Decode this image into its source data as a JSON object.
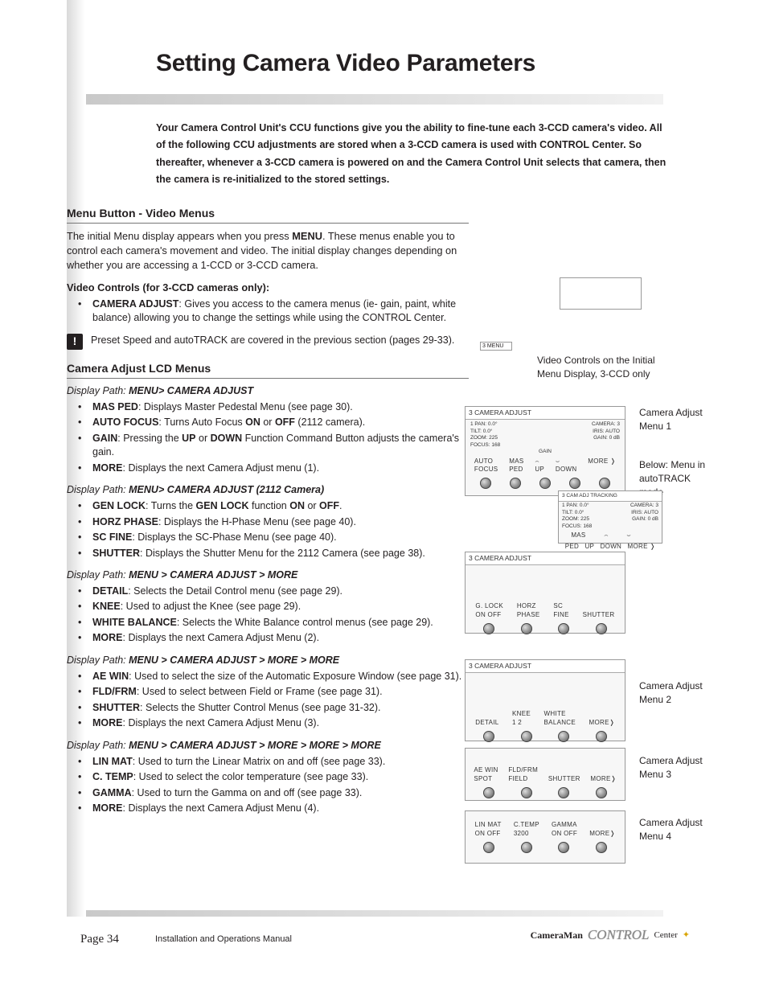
{
  "title": "Setting Camera Video Parameters",
  "intro": "Your Camera Control Unit's CCU functions give you the ability to fine-tune each 3-CCD camera's video. All of the following CCU adjustments are stored when a 3-CCD camera is used with CONTROL Center.  So thereafter, whenever a 3-CCD camera is powered on and the Camera Control Unit  selects that camera, then the camera is re-initialized to the stored settings.",
  "s1": {
    "heading": "Menu Button - Video Menus",
    "para": "The initial Menu display appears when you press <b>MENU</b>. These menus enable you to control each camera's movement and video. The initial display changes depending on whether you are accessing a 1-CCD or 3-CCD camera.",
    "sub": "Video Controls (for 3-CCD cameras only):",
    "item": "<b>CAMERA ADJUST</b>: Gives you access to the camera menus (ie- gain, paint, white balance) allowing you to change the settings while using the CONTROL Center.",
    "note": "Preset Speed and autoTRACK are covered in the previous section (pages 29-33)."
  },
  "s2": {
    "heading": "Camera Adjust LCD Menus",
    "p1_label": "Display Path:",
    "p1_path": "MENU> CAMERA ADJUST",
    "p1": {
      "a": "<b>MAS PED</b>: Displays Master Pedestal Menu (see page 30).",
      "b": "<b>AUTO FOCUS</b>: Turns Auto Focus <b>ON</b> or <b>OFF</b> (2112 camera).",
      "c": "<b>GAIN</b>: Pressing the <b>UP</b> or <b>DOWN</b> Function Command Button adjusts the camera's gain.",
      "d": "<b>MORE</b>: Displays the next Camera Adjust menu (1)."
    },
    "p2_label": "Display Path:",
    "p2_path": "MENU> CAMERA ADJUST (2112 Camera)",
    "p2": {
      "a": "<b>GEN LOCK</b>: Turns the <b>GEN LOCK</b> function <b>ON</b> or <b>OFF</b>.",
      "b": "<b>HORZ PHASE</b>: Displays the H-Phase Menu (see page 40).",
      "c": "<b>SC FINE</b>: Displays the SC-Phase Menu (see page 40).",
      "d": "<b>SHUTTER</b>: Displays the Shutter Menu for the 2112 Camera (see page 38)."
    },
    "p3_label": "Display Path:",
    "p3_path": "MENU > CAMERA ADJUST > MORE",
    "p3": {
      "a": "<b>DETAIL</b>: Selects the Detail Control menu (see page 29).",
      "b": "<b>KNEE</b>: Used to adjust the Knee (see page 29).",
      "c": "<b>WHITE BALANCE</b>: Selects the White Balance control menus (see page 29).",
      "d": "<b>MORE</b>: Displays the next Camera Adjust Menu (2)."
    },
    "p4_label": "Display Path:",
    "p4_path": "MENU > CAMERA ADJUST > MORE > MORE",
    "p4": {
      "a": "<b>AE WIN</b>: Used to select the size of the Automatic Exposure Window (see page 31).",
      "b": "<b>FLD/FRM</b>: Used to select between Field or Frame (see page 31).",
      "c": "<b>SHUTTER</b>: Selects the Shutter Control Menus (see page 31-32).",
      "d": "<b>MORE</b>: Displays the next Camera Adjust Menu (3)."
    },
    "p5_label": "Display Path:",
    "p5_path": "MENU > CAMERA ADJUST > MORE > MORE > MORE",
    "p5": {
      "a": "<b>LIN MAT</b>: Used to turn the Linear Matrix on and off (see page 33).",
      "b": "<b>C. TEMP</b>: Used to select the color temperature (see page 33).",
      "c": "<b>GAMMA</b>: Used to turn the Gamma on and off (see page 33).",
      "d": "<b>MORE</b>: Displays the next Camera Adjust Menu (4)."
    }
  },
  "caps": {
    "c0": "Video Controls on the Initial Menu Display, 3-CCD only",
    "c1a": "Camera Adjust Menu 1",
    "c1b": "Below: Menu in autoTRACK mode",
    "c2": "Camera Adjust Menu 2",
    "c3": "Camera Adjust Menu 3",
    "c4": "Camera Adjust Menu 4"
  },
  "lcd": {
    "tab3menu": "3 MENU",
    "m1_head": "3 CAMERA ADJUST",
    "m1_l1": "1  PAN: 0.0°",
    "m1_l2": "   TILT: 0.0°",
    "m1_l3": "   ZOOM: 225",
    "m1_l4": "   FOCUS: 168",
    "m1_r1": "CAMERA: 3",
    "m1_r2": "IRIS: AUTO",
    "m1_r3": "GAIN: 0 dB",
    "m1_gain": "GAIN",
    "m1_b1": "AUTO",
    "m1_b1b": "FOCUS",
    "m1_b2": "MAS",
    "m1_b2b": "PED",
    "m1_b3": "UP",
    "m1_b4": "DOWN",
    "m1_b5": "MORE ❭",
    "mt_head": "3 CAM ADJ  TRACKING",
    "m2_head": "3 CAMERA ADJUST",
    "m2_b1": "G. LOCK",
    "m2_b1b": "ON OFF",
    "m2_b2": "HORZ",
    "m2_b2b": "PHASE",
    "m2_b3": "SC",
    "m2_b3b": "FINE",
    "m2_b4": "SHUTTER",
    "m3_head": "3 CAMERA ADJUST",
    "m3_b1": "DETAIL",
    "m3_b2": "KNEE",
    "m3_b2b": "1  2",
    "m3_b3": "WHITE",
    "m3_b3b": "BALANCE",
    "m3_b4": "MORE❭",
    "m4_b1": "AE WIN",
    "m4_b1b": "SPOT",
    "m4_b2": "FLD/FRM",
    "m4_b2b": "FIELD",
    "m4_b3": "SHUTTER",
    "m4_b4": "MORE❭",
    "m5_b1": "LIN MAT",
    "m5_b1b": "ON OFF",
    "m5_b2": "C.TEMP",
    "m5_b2b": "3200",
    "m5_b3": "GAMMA",
    "m5_b3b": "ON OFF",
    "m5_b4": "MORE❭"
  },
  "footer": {
    "page": "Page 34",
    "manual": "Installation and Operations Manual",
    "brand": "CameraMan",
    "script": "CONTROL",
    "center": "Center"
  }
}
